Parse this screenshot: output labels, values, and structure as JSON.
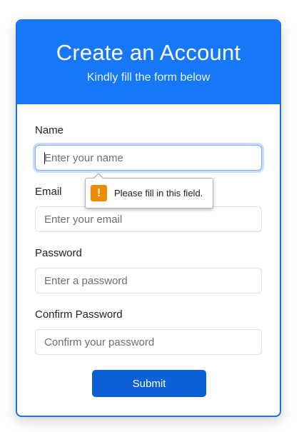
{
  "header": {
    "title": "Create an Account",
    "subtitle": "Kindly fill the form below"
  },
  "form": {
    "name": {
      "label": "Name",
      "placeholder": "Enter your name",
      "value": ""
    },
    "email": {
      "label": "Email",
      "placeholder": "Enter your email",
      "value": ""
    },
    "password": {
      "label": "Password",
      "placeholder": "Enter a password",
      "value": ""
    },
    "confirm_password": {
      "label": "Confirm Password",
      "placeholder": "Confirm your password",
      "value": ""
    },
    "submit_label": "Submit"
  },
  "validation": {
    "message": "Please fill in this field.",
    "icon": "warning-icon",
    "icon_glyph": "!"
  },
  "colors": {
    "header_bg": "#1677f7",
    "border": "#1f6fe0",
    "button_bg": "#0d5fd8",
    "warning": "#f08a00"
  }
}
